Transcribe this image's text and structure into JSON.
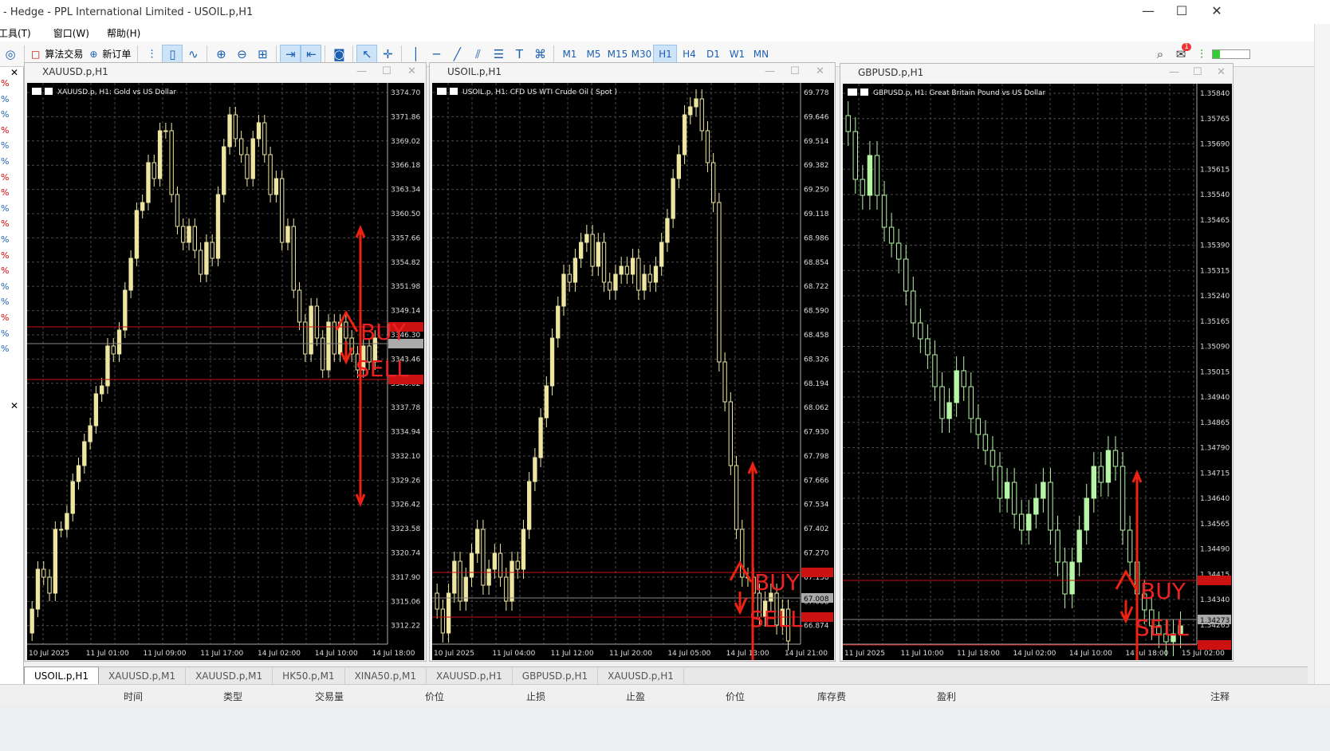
{
  "window": {
    "title": "- Hedge - PPL International Limited - USOIL.p,H1",
    "min": "—",
    "max": "☐",
    "close": "✕"
  },
  "menu": [
    "工具(T)",
    "窗口(W)",
    "帮助(H)"
  ],
  "toolbar": {
    "algo_trading": "算法交易",
    "new_order": "新订单",
    "timeframes": [
      "M1",
      "M5",
      "M15",
      "M30",
      "H1",
      "H4",
      "D1",
      "W1",
      "MN"
    ],
    "active_timeframe": "H1",
    "notification_count": "1"
  },
  "left_panel": {
    "close": "✕",
    "items": [
      "%",
      "%",
      "%",
      "%",
      "%",
      "%",
      "%",
      "%",
      "%",
      "%",
      "%",
      "%",
      "%",
      "%",
      "%",
      "%",
      "%",
      "%"
    ],
    "close2": "✕"
  },
  "charts": [
    {
      "window_title": "XAUUSD.p,H1",
      "info": "XAUUSD.p, H1:  Gold vs US Dollar",
      "price_ticks": [
        "3374.70",
        "3371.86",
        "3369.02",
        "3366.18",
        "3363.34",
        "3360.50",
        "3357.66",
        "3354.82",
        "3351.98",
        "3349.14",
        "3346.30",
        "3343.46",
        "3340.62",
        "3337.78",
        "3334.94",
        "3332.10",
        "3329.26",
        "3326.42",
        "3323.58",
        "3320.74",
        "3317.90",
        "3315.06",
        "3312.22"
      ],
      "time_ticks": [
        "10 Jul 2025",
        "11 Jul 01:00",
        "11 Jul 09:00",
        "11 Jul 17:00",
        "14 Jul 02:00",
        "14 Jul 10:00",
        "14 Jul 18:00"
      ],
      "buy_label": "BUY",
      "sell_label": "SELL"
    },
    {
      "window_title": "USOIL.p,H1",
      "info": "USOIL.p, H1:  CFD US WTI Crude Oil ( Spot )",
      "price_ticks": [
        "69.778",
        "69.646",
        "69.514",
        "69.382",
        "69.250",
        "69.118",
        "68.986",
        "68.854",
        "68.722",
        "68.590",
        "68.458",
        "68.326",
        "68.194",
        "68.062",
        "67.930",
        "67.798",
        "67.666",
        "67.534",
        "67.402",
        "67.270",
        "67.138",
        "67.008",
        "66.874"
      ],
      "time_ticks": [
        "10 Jul 2025",
        "11 Jul 04:00",
        "11 Jul 12:00",
        "11 Jul 20:00",
        "14 Jul 05:00",
        "14 Jul 13:00",
        "14 Jul 21:00"
      ],
      "current_price": "67.008",
      "buy_label": "BUY",
      "sell_label": "SELL"
    },
    {
      "window_title": "GBPUSD.p,H1",
      "info": "GBPUSD.p, H1:  Great Britain Pound vs US Dollar",
      "price_ticks": [
        "1.35840",
        "1.35765",
        "1.35690",
        "1.35615",
        "1.35540",
        "1.35465",
        "1.35390",
        "1.35315",
        "1.35240",
        "1.35165",
        "1.35090",
        "1.35015",
        "1.34940",
        "1.34865",
        "1.34790",
        "1.34715",
        "1.34640",
        "1.34565",
        "1.34490",
        "1.34415",
        "1.34340",
        "1.34265"
      ],
      "time_ticks": [
        "11 Jul 2025",
        "11 Jul 10:00",
        "11 Jul 18:00",
        "14 Jul 02:00",
        "14 Jul 10:00",
        "14 Jul 18:00",
        "15 Jul 02:00"
      ],
      "current_price": "1.34273",
      "buy_label": "BUY",
      "sell_label": "SELL"
    }
  ],
  "tabs": [
    "USOIL.p,H1",
    "XAUUSD.p,M1",
    "XAUUSD.p,M1",
    "HK50.p,M1",
    "XINA50.p,M1",
    "XAUUSD.p,H1",
    "GBPUSD.p,H1",
    "XAUUSD.p,H1"
  ],
  "active_tab": 0,
  "status_columns": [
    "时间",
    "类型",
    "交易量",
    "价位",
    "止损",
    "止盈",
    "价位",
    "库存费",
    "盈利",
    "注释"
  ],
  "colors": {
    "bull": "#f0eaa0",
    "bear": "#f0eaa0",
    "gbp": "#a8f0a0",
    "line": "#cc1111",
    "grid": "#555555"
  }
}
